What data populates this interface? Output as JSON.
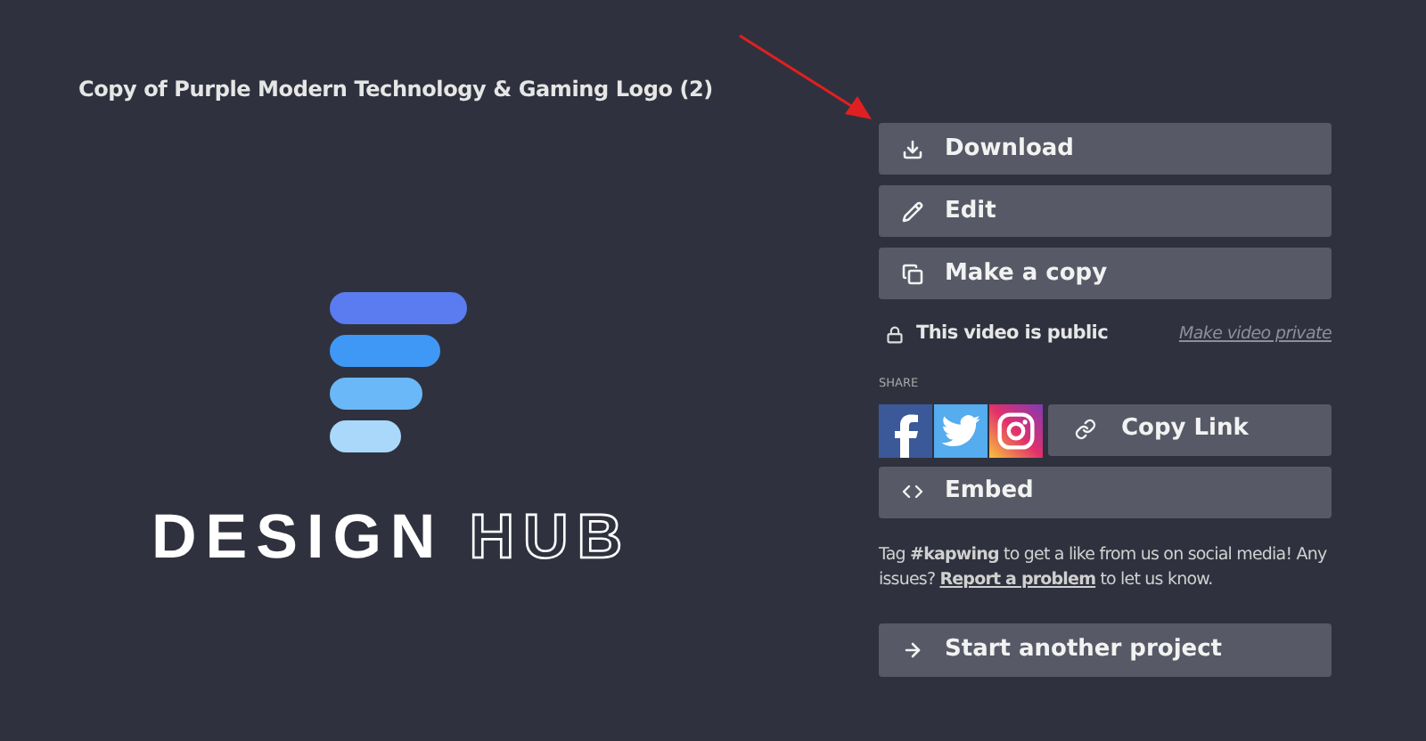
{
  "title": "Copy of Purple Modern Technology & Gaming Logo (2)",
  "preview": {
    "word_1": "DESIGN",
    "word_2": "HUB"
  },
  "actions": [
    {
      "kind": "download",
      "label": "Download"
    },
    {
      "kind": "edit",
      "label": "Edit"
    },
    {
      "kind": "copy",
      "label": "Make a copy"
    }
  ],
  "privacy": {
    "status": "This video is public",
    "link": "Make video private"
  },
  "share": {
    "label": "SHARE",
    "networks": [
      {
        "kind": "facebook"
      },
      {
        "kind": "twitter"
      },
      {
        "kind": "instagram"
      }
    ],
    "copy_link": "Copy Link"
  },
  "embed": "Embed",
  "note": {
    "before": "Tag **#kapwing** to get a like from us on social media! Any issues? ",
    "link": "Report a problem",
    "after": " to let us know."
  },
  "start": "Start another project"
}
